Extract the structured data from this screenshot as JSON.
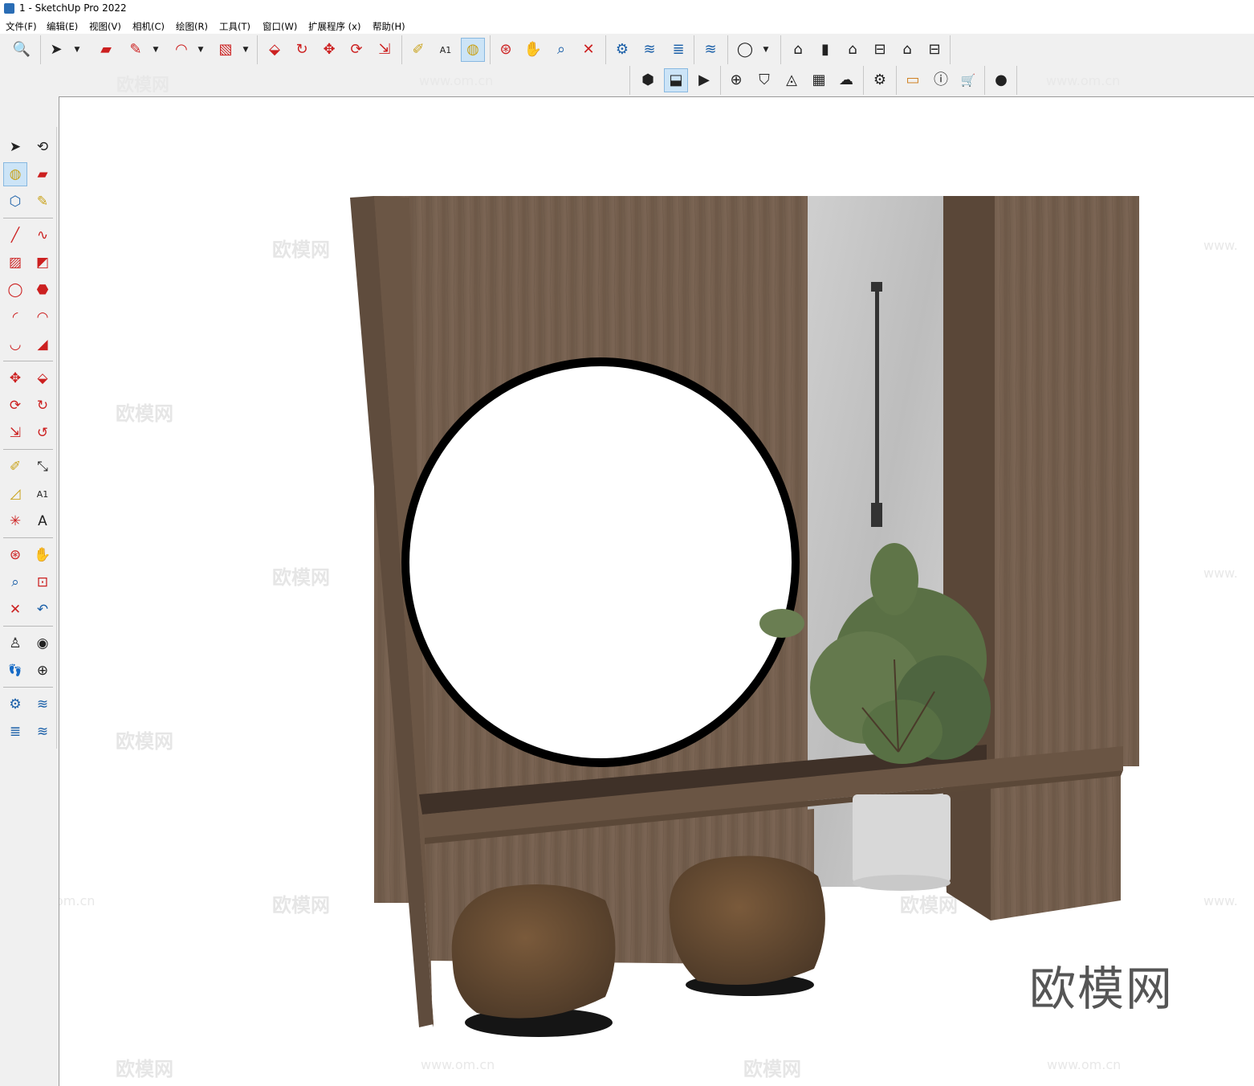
{
  "window": {
    "title": "1 - SketchUp Pro 2022"
  },
  "menu": [
    "文件(F)",
    "编辑(E)",
    "视图(V)",
    "相机(C)",
    "绘图(R)",
    "工具(T)",
    "窗口(W)",
    "扩展程序 (x)",
    "帮助(H)"
  ],
  "toolbar_main": [
    {
      "icon": "search-icon",
      "glyph": "🔍"
    },
    {
      "icon": "select-arrow-icon",
      "glyph": "➤"
    },
    {
      "icon": "eraser-icon",
      "glyph": "▰"
    },
    {
      "icon": "pencil-icon",
      "glyph": "✎"
    },
    {
      "icon": "arc-icon",
      "glyph": "◠"
    },
    {
      "icon": "rectangle-icon",
      "glyph": "▧"
    },
    {
      "icon": "push-pull-icon",
      "glyph": "⬙"
    },
    {
      "icon": "follow-me-icon",
      "glyph": "↻"
    },
    {
      "icon": "move-icon",
      "glyph": "✥"
    },
    {
      "icon": "rotate-icon",
      "glyph": "⟳"
    },
    {
      "icon": "scale-icon",
      "glyph": "⇲"
    },
    {
      "icon": "tape-measure-icon",
      "glyph": "✐"
    },
    {
      "icon": "text-icon",
      "glyph": "A1"
    },
    {
      "icon": "paint-bucket-icon",
      "glyph": "◍"
    },
    {
      "icon": "orbit-icon",
      "glyph": "⊛"
    },
    {
      "icon": "pan-icon",
      "glyph": "✋"
    },
    {
      "icon": "zoom-icon",
      "glyph": "⌕"
    },
    {
      "icon": "zoom-extents-icon",
      "glyph": "✕"
    },
    {
      "icon": "warehouse-icon",
      "glyph": "⚙"
    },
    {
      "icon": "extension-warehouse-icon",
      "glyph": "≋"
    },
    {
      "icon": "layers-icon",
      "glyph": "≣"
    },
    {
      "icon": "extension-manager-icon",
      "glyph": "≋"
    },
    {
      "icon": "account-icon",
      "glyph": "◯"
    },
    {
      "icon": "iso-view-icon",
      "glyph": "⌂"
    },
    {
      "icon": "front-view-icon",
      "glyph": "▮"
    },
    {
      "icon": "home-view-icon",
      "glyph": "⌂"
    },
    {
      "icon": "top-view-icon",
      "glyph": "⊟"
    },
    {
      "icon": "right-view-icon",
      "glyph": "⌂"
    },
    {
      "icon": "back-view-icon",
      "glyph": "⊟"
    }
  ],
  "toolbar_second": [
    {
      "icon": "styles-icon",
      "glyph": "⬢"
    },
    {
      "icon": "scenes-icon",
      "glyph": "⬓"
    },
    {
      "icon": "camera-icon",
      "glyph": "▶"
    },
    {
      "icon": "add-icon",
      "glyph": "⊕"
    },
    {
      "icon": "shield-icon",
      "glyph": "⛉"
    },
    {
      "icon": "solar-icon",
      "glyph": "◬"
    },
    {
      "icon": "checker-icon",
      "glyph": "▦"
    },
    {
      "icon": "cloud-upload-icon",
      "glyph": "☁"
    },
    {
      "icon": "settings-icon",
      "glyph": "⚙"
    },
    {
      "icon": "chat-icon",
      "glyph": "▭"
    },
    {
      "icon": "info-icon",
      "glyph": "ⓘ"
    },
    {
      "icon": "cart-icon",
      "glyph": "🛒"
    },
    {
      "icon": "profile-icon",
      "glyph": "●"
    }
  ],
  "left_tools": [
    {
      "icon": "select-icon",
      "glyph": "➤"
    },
    {
      "icon": "orbit-select-icon",
      "glyph": "⟲"
    },
    {
      "icon": "paint-icon",
      "glyph": "◍"
    },
    {
      "icon": "eraser-icon",
      "glyph": "▰"
    },
    {
      "icon": "component-icon",
      "glyph": "⬡"
    },
    {
      "icon": "sample-icon",
      "glyph": "✎"
    },
    {
      "icon": "line-icon",
      "glyph": "╱"
    },
    {
      "icon": "freehand-icon",
      "glyph": "∿"
    },
    {
      "icon": "rectangle-icon",
      "glyph": "▨"
    },
    {
      "icon": "rotated-rect-icon",
      "glyph": "◩"
    },
    {
      "icon": "circle-icon",
      "glyph": "◯"
    },
    {
      "icon": "polygon-icon",
      "glyph": "⬣"
    },
    {
      "icon": "arc-icon",
      "glyph": "◜"
    },
    {
      "icon": "2pt-arc-icon",
      "glyph": "◠"
    },
    {
      "icon": "3pt-arc-icon",
      "glyph": "◡"
    },
    {
      "icon": "pie-icon",
      "glyph": "◢"
    },
    {
      "icon": "move-icon",
      "glyph": "✥"
    },
    {
      "icon": "push-pull-icon",
      "glyph": "⬙"
    },
    {
      "icon": "rotate-icon",
      "glyph": "⟳"
    },
    {
      "icon": "follow-me-icon",
      "glyph": "↻"
    },
    {
      "icon": "scale-icon",
      "glyph": "⇲"
    },
    {
      "icon": "offset-icon",
      "glyph": "↺"
    },
    {
      "icon": "tape-icon",
      "glyph": "✐"
    },
    {
      "icon": "dimension-icon",
      "glyph": "⤡"
    },
    {
      "icon": "protractor-icon",
      "glyph": "◿"
    },
    {
      "icon": "text-icon",
      "glyph": "A1"
    },
    {
      "icon": "axes-icon",
      "glyph": "✳"
    },
    {
      "icon": "3d-text-icon",
      "glyph": "A"
    },
    {
      "icon": "orbit-icon",
      "glyph": "⊛"
    },
    {
      "icon": "pan-icon",
      "glyph": "✋"
    },
    {
      "icon": "zoom-icon",
      "glyph": "⌕"
    },
    {
      "icon": "zoom-window-icon",
      "glyph": "⊡"
    },
    {
      "icon": "zoom-extents-icon",
      "glyph": "✕"
    },
    {
      "icon": "previous-icon",
      "glyph": "↶"
    },
    {
      "icon": "position-camera-icon",
      "glyph": "♙"
    },
    {
      "icon": "look-around-icon",
      "glyph": "◉"
    },
    {
      "icon": "walk-icon",
      "glyph": "👣"
    },
    {
      "icon": "section-plane-icon",
      "glyph": "⊕"
    },
    {
      "icon": "warehouse-icon",
      "glyph": "⚙"
    },
    {
      "icon": "extension-warehouse-icon",
      "glyph": "≋"
    },
    {
      "icon": "layers-icon",
      "glyph": "≣"
    },
    {
      "icon": "extension-manager-icon",
      "glyph": "≋"
    }
  ],
  "watermark": {
    "site": "欧模网",
    "url": "www.om.cn",
    "partial_url": "om.cn",
    "partial_url2": "www.",
    "logo": "欧模网"
  }
}
